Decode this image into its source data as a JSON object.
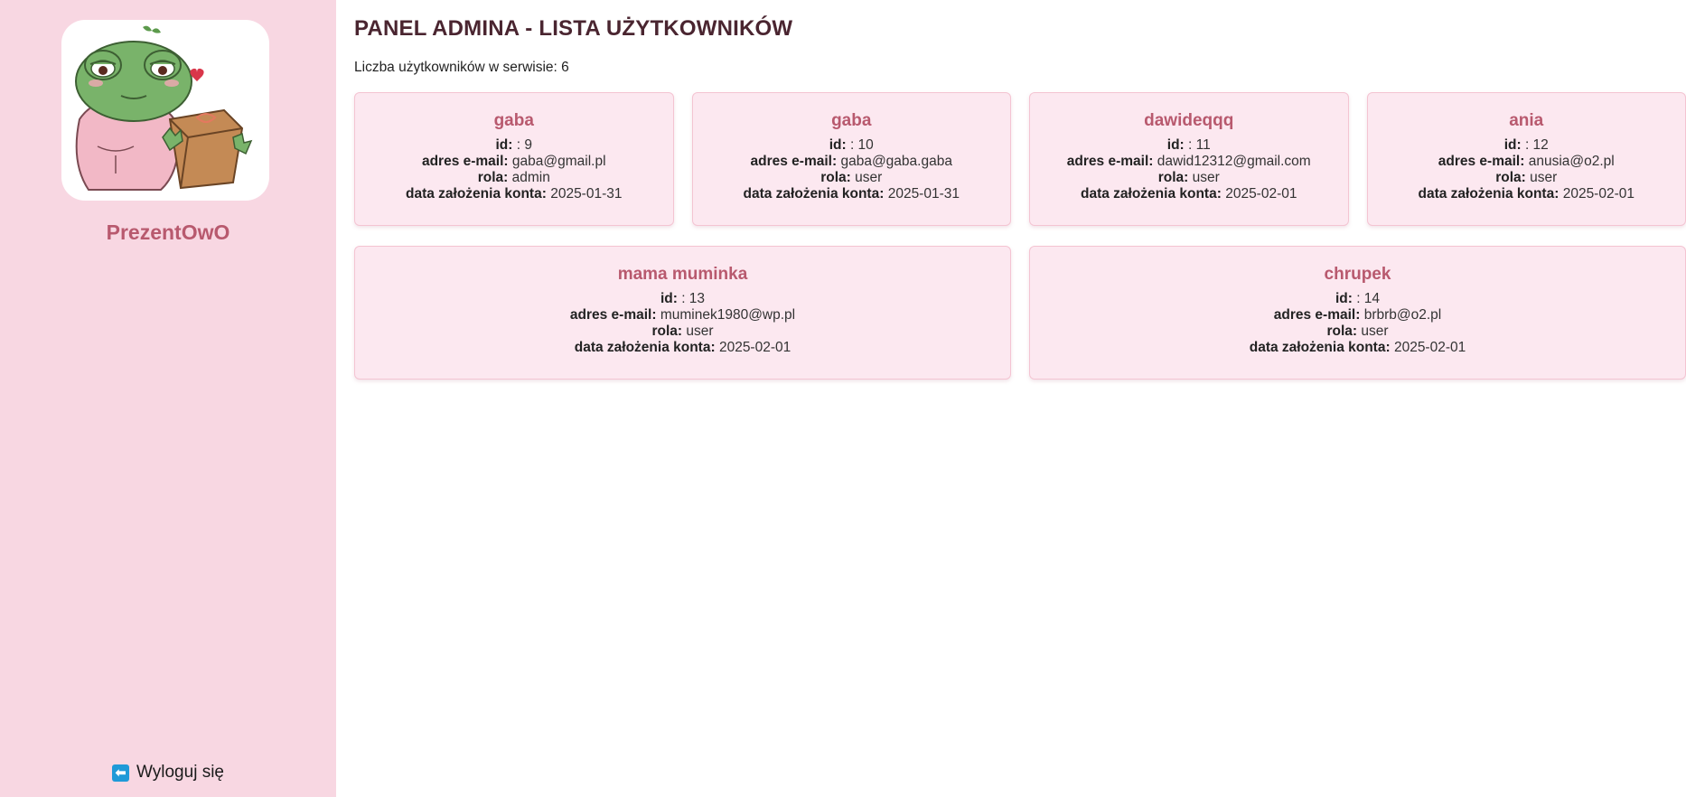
{
  "sidebar": {
    "brand": "PrezentOwO",
    "logout_label": "Wyloguj się",
    "logout_icon": "arrow-left-icon",
    "accent_color": "#b8596e",
    "background_color": "#f8d7e2"
  },
  "main": {
    "title": "PANEL ADMINA - LISTA UŻYTKOWNIKÓW",
    "user_count": "Liczba użytkowników w serwisie: 6",
    "field_labels": {
      "id": "id:",
      "email": "adres e-mail:",
      "role": "rola:",
      "created": "data założenia konta:"
    },
    "users": [
      {
        "name": "gaba",
        "id": ": 9",
        "email": "gaba@gmail.pl",
        "role": "admin",
        "created": "2025-01-31"
      },
      {
        "name": "gaba",
        "id": ": 10",
        "email": "gaba@gaba.gaba",
        "role": "user",
        "created": "2025-01-31"
      },
      {
        "name": "dawideqqq",
        "id": ": 11",
        "email": "dawid12312@gmail.com",
        "role": "user",
        "created": "2025-02-01"
      },
      {
        "name": "ania",
        "id": ": 12",
        "email": "anusia@o2.pl",
        "role": "user",
        "created": "2025-02-01"
      },
      {
        "name": "mama muminka",
        "id": ": 13",
        "email": "muminek1980@wp.pl",
        "role": "user",
        "created": "2025-02-01"
      },
      {
        "name": "chrupek",
        "id": ": 14",
        "email": "brbrb@o2.pl",
        "role": "user",
        "created": "2025-02-01"
      }
    ]
  }
}
